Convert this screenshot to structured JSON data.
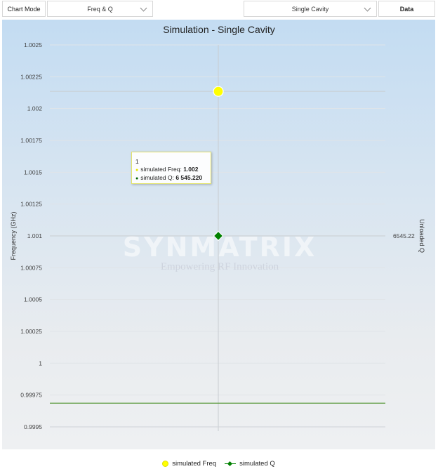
{
  "toolbar": {
    "chart_mode_label": "Chart Mode",
    "mode_value": "Freq & Q",
    "cavity_value": "Single Cavity",
    "data_button": "Data"
  },
  "colors": {
    "freq_marker": "#ffff00",
    "q_marker": "#008000",
    "q_line": "#5a9a3c"
  },
  "watermark": {
    "brand": "SYNMATRIX",
    "tagline": "Empowering RF Innovation"
  },
  "tooltip": {
    "header": "1",
    "freq_label": "simulated Freq: ",
    "freq_value": "1.002",
    "q_label": "simulated Q: ",
    "q_value": "6 545.220"
  },
  "legend": {
    "freq": "simulated Freq",
    "q": "simulated Q"
  },
  "chart_data": {
    "type": "scatter",
    "title": "Simulation - Single Cavity",
    "xlabel": "",
    "ylabel": "Frequency (GHz)",
    "y2label": "Unloaded Q",
    "categories": [
      "1"
    ],
    "y_ticks": [
      "1.0025",
      "1.00225",
      "1.002",
      "1.00175",
      "1.0015",
      "1.00125",
      "1.001",
      "1.00075",
      "1.0005",
      "1.00025",
      "1",
      "0.99975",
      "0.9995"
    ],
    "ylim": [
      0.9995,
      1.0025
    ],
    "y2_tick_labels": [
      "6545.22"
    ],
    "series": [
      {
        "name": "simulated Freq",
        "axis": "left",
        "marker": "circle",
        "values": [
          1.002135
        ]
      },
      {
        "name": "simulated Q",
        "axis": "right",
        "marker": "diamond",
        "values": [
          6545.22
        ]
      }
    ],
    "q_reference_line": {
      "axis": "left",
      "value": 0.999686
    },
    "grid": true,
    "legend_position": "bottom"
  }
}
